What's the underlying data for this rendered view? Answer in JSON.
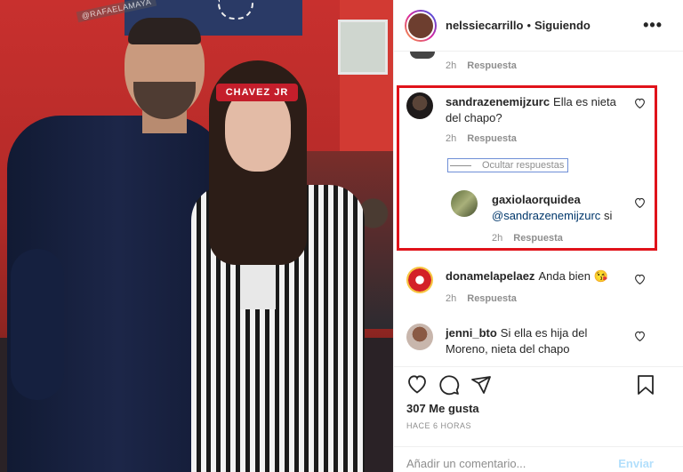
{
  "photo": {
    "watermark": "@RAFAELAMAYA",
    "headband_text": "CHAVEZ JR"
  },
  "header": {
    "username": "nelssiecarrillo",
    "separator": "•",
    "follow_label": "Siguiendo",
    "more_label": "•••"
  },
  "top_comment": {
    "time": "2h",
    "reply_label": "Respuesta"
  },
  "comments": [
    {
      "username": "sandrazenemijzurc",
      "text": "Ella es nieta del chapo?",
      "time": "2h",
      "reply_label": "Respuesta"
    },
    {
      "username": "donamelapelaez",
      "text": "Anda bien 😘",
      "time": "2h",
      "reply_label": "Respuesta"
    },
    {
      "username": "jenni_bto",
      "text": "Si ella es hija del Moreno, nieta del chapo",
      "time": "",
      "reply_label": ""
    }
  ],
  "hide_replies_label": "Ocultar respuestas",
  "reply": {
    "username": "gaxiolaorquidea",
    "mention": "@sandrazenemijzurc",
    "text": "si",
    "time": "2h",
    "reply_label": "Respuesta"
  },
  "likes_label": "307 Me gusta",
  "timestamp": "HACE 6 HORAS",
  "composer": {
    "placeholder": "Añadir un comentario...",
    "send_label": "Enviar"
  },
  "colors": {
    "highlight_border": "#e0121a",
    "link": "#00376b",
    "muted": "#8e8e8e",
    "send_disabled": "#b2dffc"
  },
  "icons": [
    "heart-icon",
    "comment-icon",
    "share-icon",
    "bookmark-icon",
    "more-icon"
  ]
}
